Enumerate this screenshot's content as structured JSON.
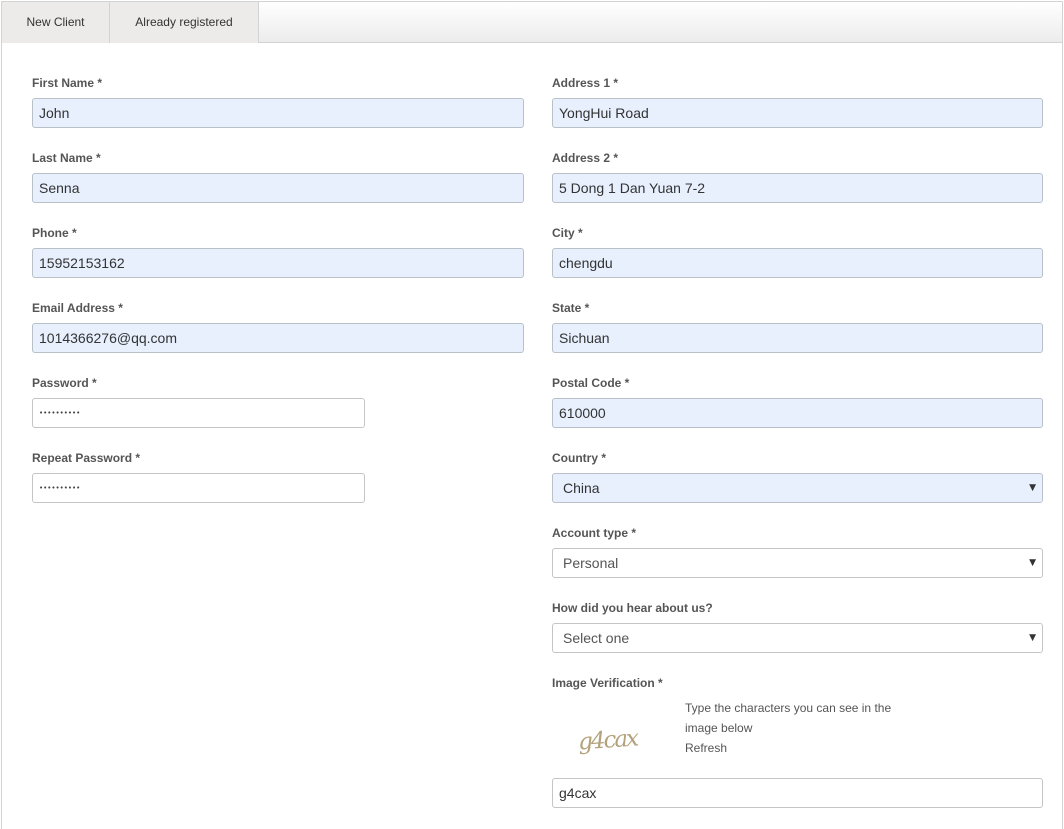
{
  "tabs": [
    {
      "label": "New Client"
    },
    {
      "label": "Already registered"
    }
  ],
  "left": {
    "first_name": {
      "label": "First Name *",
      "value": "John"
    },
    "last_name": {
      "label": "Last Name *",
      "value": "Senna"
    },
    "phone": {
      "label": "Phone *",
      "value": "15952153162"
    },
    "email": {
      "label": "Email Address *",
      "value": "1014366276@qq.com"
    },
    "password": {
      "label": "Password *",
      "value": "••••••••••"
    },
    "repeat_password": {
      "label": "Repeat Password *",
      "value": "••••••••••"
    }
  },
  "right": {
    "address1": {
      "label": "Address 1 *",
      "value": "YongHui Road"
    },
    "address2": {
      "label": "Address 2 *",
      "value": "5 Dong 1 Dan Yuan 7-2"
    },
    "city": {
      "label": "City *",
      "value": "chengdu"
    },
    "state": {
      "label": "State *",
      "value": "Sichuan"
    },
    "postal_code": {
      "label": "Postal Code *",
      "value": "610000"
    },
    "country": {
      "label": "Country *",
      "value": "China"
    },
    "account_type": {
      "label": "Account type *",
      "value": "Personal"
    },
    "heard_about": {
      "label": "How did you hear about us?",
      "value": "Select one"
    },
    "verification": {
      "label": "Image Verification *",
      "instruction_line1": "Type the characters you can see in the",
      "instruction_line2": "image below",
      "refresh": "Refresh",
      "captcha_text": "g4cax",
      "value": "g4cax"
    }
  },
  "icons": {
    "caret": "▼"
  },
  "colors": {
    "autofill_bg": "#e8f0fe",
    "label": "#555555",
    "border": "#b9c0c8"
  }
}
